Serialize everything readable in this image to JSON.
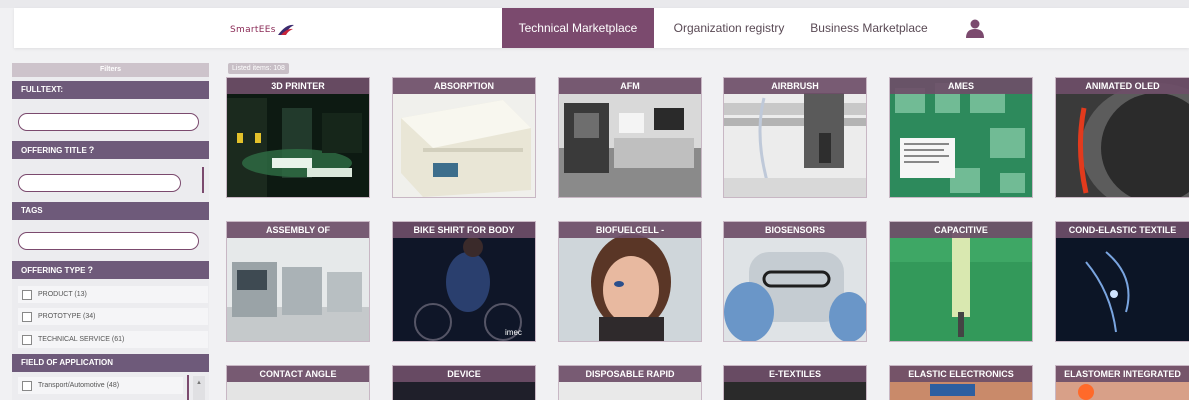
{
  "header": {
    "logo_text": "SmartEEs",
    "nav": [
      {
        "label": "Technical Marketplace",
        "active": true
      },
      {
        "label": "Organization registry",
        "active": false
      },
      {
        "label": "Business Marketplace",
        "active": false
      }
    ],
    "user_icon": "user-icon"
  },
  "sidebar": {
    "title": "Filters",
    "fulltext_label": "FULLTEXT:",
    "offering_title_label": "OFFERING TITLE",
    "tags_label": "TAGS",
    "offering_type_label": "OFFERING TYPE",
    "offering_types": [
      {
        "label": "PRODUCT (13)"
      },
      {
        "label": "PROTOTYPE (34)"
      },
      {
        "label": "TECHNICAL SERVICE (61)"
      }
    ],
    "field_label": "FIELD OF APPLICATION",
    "fields": [
      {
        "label": "Transport/Automotive (48)"
      }
    ],
    "help_glyph": "?"
  },
  "main": {
    "listed_items": "Listed items: 108",
    "cards": [
      {
        "title": "3D PRINTER"
      },
      {
        "title": "ABSORPTION"
      },
      {
        "title": "AFM"
      },
      {
        "title": "AIRBRUSH"
      },
      {
        "title": "AMES"
      },
      {
        "title": "ANIMATED OLED"
      },
      {
        "title": "ASSEMBLY OF"
      },
      {
        "title": "BIKE SHIRT FOR BODY"
      },
      {
        "title": "BIOFUELCELL -"
      },
      {
        "title": "BIOSENSORS"
      },
      {
        "title": "CAPACITIVE"
      },
      {
        "title": "COND-ELASTIC TEXTILE"
      },
      {
        "title": "CONTACT ANGLE"
      },
      {
        "title": "DEVICE"
      },
      {
        "title": "DISPOSABLE RAPID"
      },
      {
        "title": "E-TEXTILES"
      },
      {
        "title": "ELASTIC ELECTRONICS"
      },
      {
        "title": "ELASTOMER INTEGRATED"
      }
    ],
    "card_image_texts": {
      "bike_brand": "imec"
    }
  },
  "colors": {
    "accent": "#7b4a6e",
    "filter_head": "#6e5a7a"
  }
}
